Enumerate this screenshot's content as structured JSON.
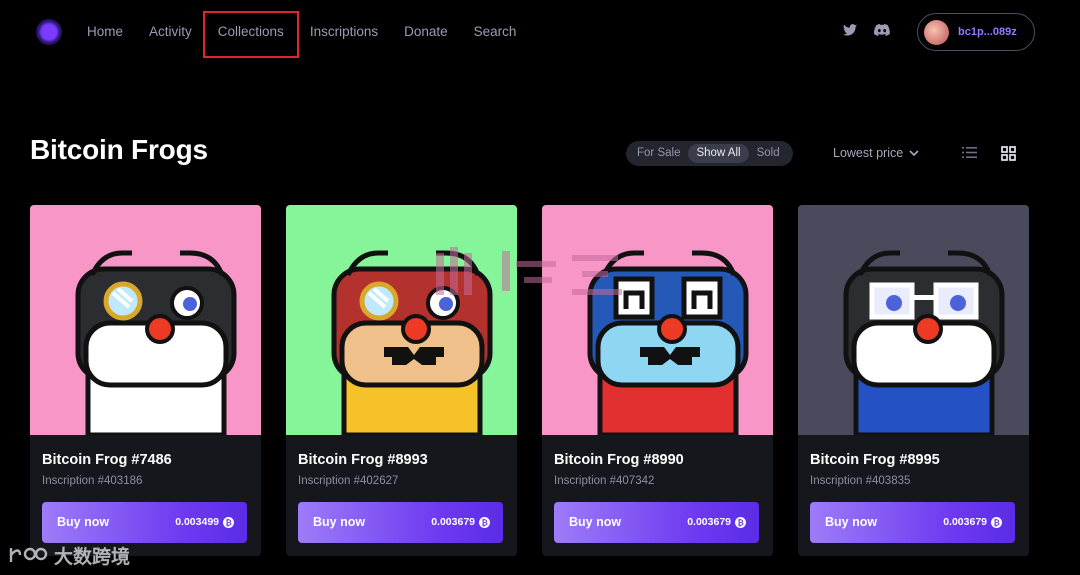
{
  "nav": {
    "links": [
      "Home",
      "Activity",
      "Collections",
      "Inscriptions",
      "Donate",
      "Search"
    ],
    "highlighted": "Collections",
    "wallet_address": "bc1p...089z"
  },
  "header": {
    "title": "Bitcoin Frogs",
    "filters": [
      "For Sale",
      "Show All",
      "Sold"
    ],
    "active_filter": "Show All",
    "sort_label": "Lowest price"
  },
  "cards": [
    {
      "name": "Bitcoin Frog #7486",
      "inscription": "Inscription #403186",
      "buy_label": "Buy now",
      "price": "0.003499",
      "bg": "#f896c8",
      "skin": "#2c2d31",
      "mask": "#3d3f45",
      "face": "#ffffff",
      "body": "#ffffff",
      "eyewear": "monocle"
    },
    {
      "name": "Bitcoin Frog #8993",
      "inscription": "Inscription #402627",
      "buy_label": "Buy now",
      "price": "0.003679",
      "bg": "#86f59a",
      "skin": "#b3322d",
      "mask": "#8e2623",
      "face": "#f0c08a",
      "body": "#f5c22a",
      "eyewear": "monocle"
    },
    {
      "name": "Bitcoin Frog #8990",
      "inscription": "Inscription #407342",
      "buy_label": "Buy now",
      "price": "0.003679",
      "bg": "#f896c8",
      "skin": "#2559b8",
      "mask": "#1b47a0",
      "face": "#8fd6f2",
      "body": "#e22f2f",
      "eyewear": "none"
    },
    {
      "name": "Bitcoin Frog #8995",
      "inscription": "Inscription #403835",
      "buy_label": "Buy now",
      "price": "0.003679",
      "bg": "#4b4a5c",
      "skin": "#2c2d31",
      "mask": "#3d3f45",
      "face": "#ffffff",
      "body": "#2452c4",
      "eyewear": "glasses"
    }
  ],
  "watermark": {
    "brand": "大数跨境"
  }
}
